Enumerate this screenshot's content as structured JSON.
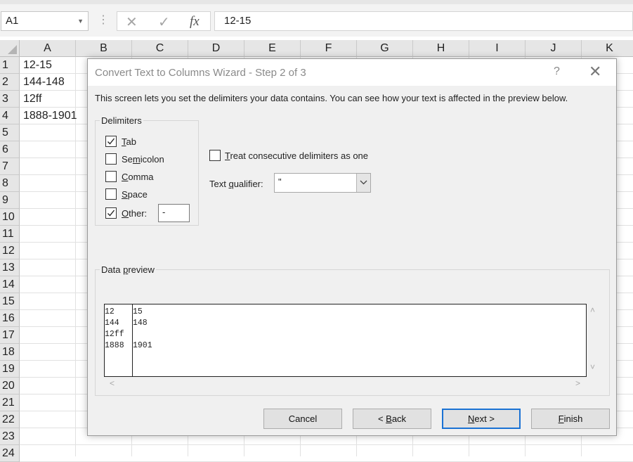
{
  "formula_bar": {
    "name_box": "A1",
    "cancel_glyph": "✕",
    "enter_glyph": "✓",
    "fx_glyph": "fx",
    "value": "12-15",
    "separator": "⋮"
  },
  "grid": {
    "columns": [
      "A",
      "B",
      "C",
      "D",
      "E",
      "F",
      "G",
      "H",
      "I",
      "J",
      "K"
    ],
    "rows": [
      "1",
      "2",
      "3",
      "4",
      "5",
      "6",
      "7",
      "8",
      "9",
      "10",
      "11",
      "12",
      "13",
      "14",
      "15",
      "16",
      "17",
      "18",
      "19",
      "20",
      "21",
      "22",
      "23",
      "24"
    ],
    "column_a_values": [
      "12-15",
      "144-148",
      "12ff",
      "1888-1901"
    ]
  },
  "dialog": {
    "title": "Convert Text to Columns Wizard - Step 2 of 3",
    "help_glyph": "?",
    "close_glyph": "✕",
    "description": "This screen lets you set the delimiters your data contains.  You can see how your text is affected in the preview below.",
    "delimiters": {
      "legend": "Delimiters",
      "tab": {
        "label": "Tab",
        "checked": true
      },
      "semicolon": {
        "label": "Semicolon",
        "checked": false
      },
      "comma": {
        "label": "Comma",
        "checked": false
      },
      "space": {
        "label": "Space",
        "checked": false
      },
      "other": {
        "label": "Other:",
        "checked": true,
        "value": "-"
      }
    },
    "consecutive": {
      "label": "Treat consecutive delimiters as one",
      "checked": false
    },
    "text_qualifier": {
      "label": "Text qualifier:",
      "value": "\""
    },
    "data_preview": {
      "legend": "Data preview",
      "rows": [
        [
          "12",
          "15"
        ],
        [
          "144",
          "148"
        ],
        [
          "12ff",
          ""
        ],
        [
          "1888",
          "1901"
        ]
      ]
    },
    "buttons": {
      "cancel": "Cancel",
      "back": "< Back",
      "next": "Next >",
      "finish": "Finish"
    }
  },
  "colors": {
    "accent": "#1a72d4",
    "dialog_bg": "#f0f0f0",
    "header_bg": "#e6e6e6"
  },
  "icons": {
    "check": "check-icon",
    "dropdown": "chevron-down-icon",
    "close": "close-icon",
    "help": "help-icon"
  }
}
